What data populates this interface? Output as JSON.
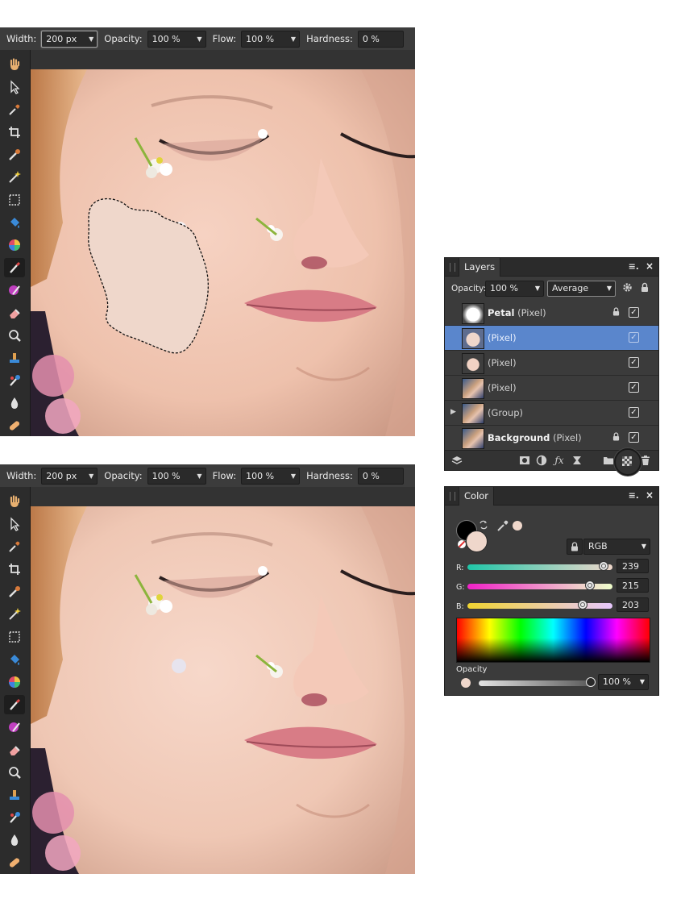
{
  "context_bar": {
    "width_label": "Width:",
    "width_value": "200 px",
    "opacity_label": "Opacity:",
    "opacity_value": "100 %",
    "flow_label": "Flow:",
    "flow_value": "100 %",
    "hardness_label": "Hardness:",
    "hardness_value": "0 %"
  },
  "tools": [
    "hand-icon",
    "move-pointer-icon",
    "eyedropper-icon",
    "crop-icon",
    "selection-brush-icon",
    "magic-wand-icon",
    "marquee-icon",
    "flood-fill-icon",
    "color-wheel-icon",
    "paint-brush-icon",
    "color-replace-brush-icon",
    "eraser-icon",
    "zoom-icon",
    "clone-stamp-icon",
    "retouch-brush-icon",
    "blur-drop-icon",
    "healing-bandage-icon"
  ],
  "layers_panel": {
    "title": "Layers",
    "opacity_label": "Opacity:",
    "opacity_value": "100 %",
    "blend_mode": "Average",
    "rows": [
      {
        "name": "Petal",
        "type": "(Pixel)",
        "bold": true,
        "locked": true,
        "selected": false,
        "expandable": false,
        "visible": true
      },
      {
        "name": "",
        "type": "(Pixel)",
        "bold": false,
        "locked": false,
        "selected": true,
        "expandable": false,
        "visible": true
      },
      {
        "name": "",
        "type": "(Pixel)",
        "bold": false,
        "locked": false,
        "selected": false,
        "expandable": false,
        "visible": true
      },
      {
        "name": "",
        "type": "(Pixel)",
        "bold": false,
        "locked": false,
        "selected": false,
        "expandable": false,
        "visible": true
      },
      {
        "name": "",
        "type": "(Group)",
        "bold": false,
        "locked": false,
        "selected": false,
        "expandable": true,
        "visible": true
      },
      {
        "name": "Background",
        "type": "(Pixel)",
        "bold": true,
        "locked": true,
        "selected": false,
        "expandable": false,
        "visible": true
      }
    ]
  },
  "color_panel": {
    "title": "Color",
    "model": "RGB",
    "r_label": "R:",
    "r_value": "239",
    "g_label": "G:",
    "g_value": "215",
    "b_label": "B:",
    "b_value": "203",
    "r_fraction": 0.937,
    "g_fraction": 0.843,
    "b_fraction": 0.796,
    "opacity_label": "Opacity",
    "opacity_value": "100 %",
    "primary_color": "#efd7cb",
    "secondary_color": "#000000"
  },
  "colors": {
    "skin_fill": "#efd7cb",
    "selection_blue": "#5a86cc"
  }
}
